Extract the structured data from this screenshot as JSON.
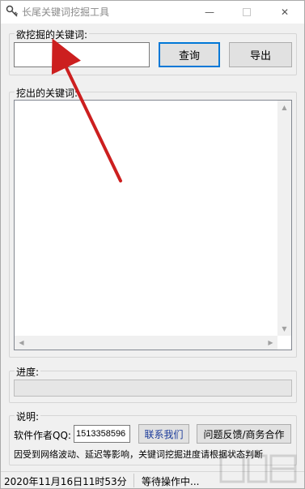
{
  "window": {
    "title": "长尾关键词挖掘工具",
    "controls": {
      "minimize": "—",
      "close": "✕"
    }
  },
  "query_group": {
    "legend": "欲挖掘的关键词:",
    "input_value": "",
    "query_button": "查询",
    "export_button": "导出"
  },
  "results_group": {
    "legend": "挖出的关键词:",
    "items": []
  },
  "progress_group": {
    "legend": "进度:",
    "percent": 0
  },
  "info_group": {
    "legend": "说明:",
    "qq_label": "软件作者QQ:",
    "qq_value": "1513358596",
    "contact_button": "联系我们",
    "feedback_button": "问题反馈/商务合作",
    "notice": "因受到网络波动、延迟等影响，关键词挖掘进度请根据状态判断"
  },
  "statusbar": {
    "datetime": "2020年11月16日11时53分",
    "status": "等待操作中..."
  },
  "colors": {
    "annotation_arrow": "#cc1f1f",
    "primary_border": "#0078d7"
  },
  "icons": {
    "app": "key-icon",
    "watermark": "watermark-logo"
  }
}
